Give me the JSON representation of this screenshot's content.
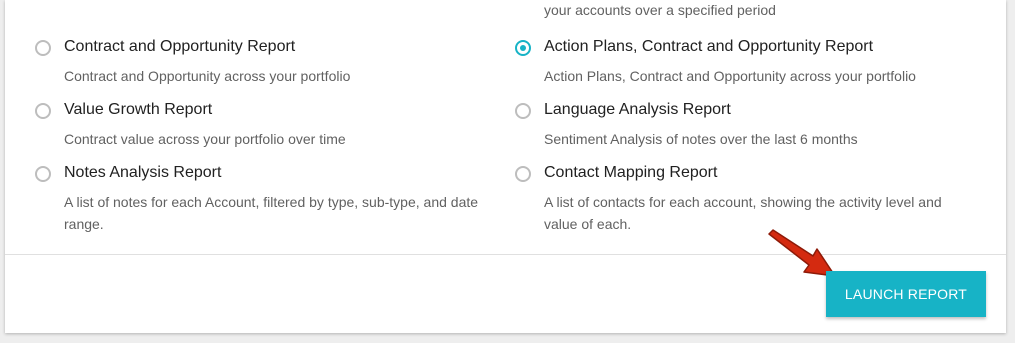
{
  "top_partial_description": "your accounts over a specified period",
  "reports": [
    {
      "title": "Contract and Opportunity Report",
      "description": "Contract and Opportunity across your portfolio",
      "selected": false
    },
    {
      "title": "Action Plans, Contract and Opportunity Report",
      "description": "Action Plans, Contract and Opportunity across your portfolio",
      "selected": true
    },
    {
      "title": "Value Growth Report",
      "description": "Contract value across your portfolio over time",
      "selected": false
    },
    {
      "title": "Language Analysis Report",
      "description": "Sentiment Analysis of notes over the last 6 months",
      "selected": false
    },
    {
      "title": "Notes Analysis Report",
      "description": "A list of notes for each Account, filtered by type, sub-type, and date range.",
      "selected": false
    },
    {
      "title": "Contact Mapping Report",
      "description": "A list of contacts for each account, showing the activity level and value of each.",
      "selected": false
    }
  ],
  "launch_button_label": "LAUNCH REPORT",
  "colors": {
    "accent": "#17b3c6",
    "arrow": "#d42a10"
  }
}
